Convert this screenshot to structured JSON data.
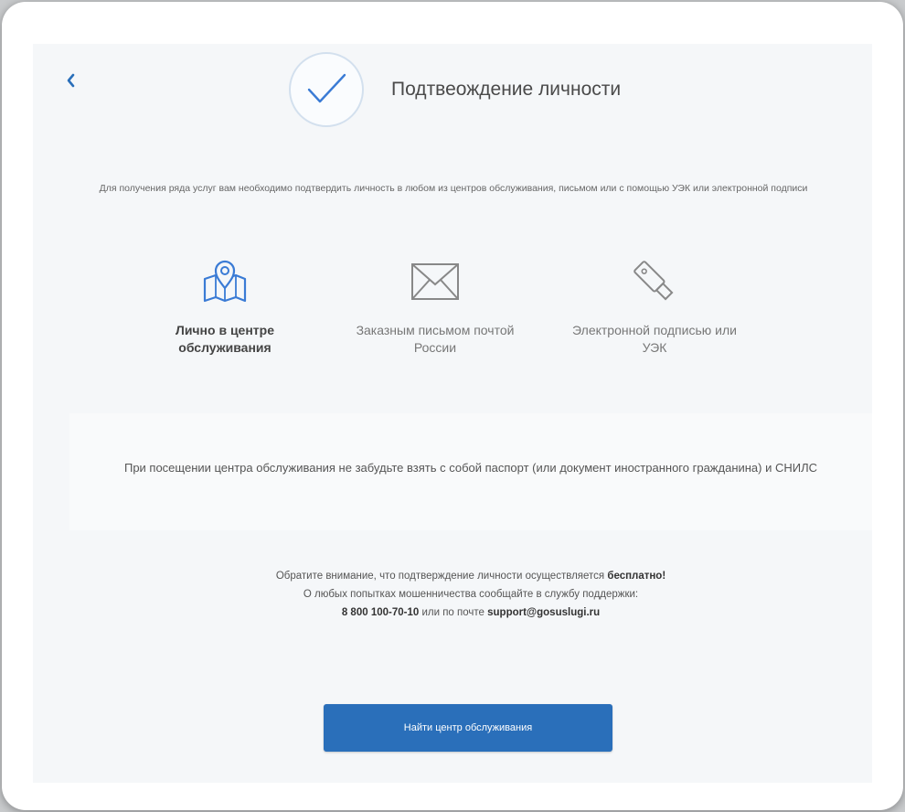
{
  "header": {
    "title": "Подтвеождение личности"
  },
  "intro": {
    "text": "Для получения ряда услуг вам необходимо подтвердить личность в любом из центров обслуживания, письмом или с помощью УЭК или электронной подписи"
  },
  "methods": [
    {
      "label": "Лично в центре обслуживания",
      "icon": "map-pin-icon",
      "active": true
    },
    {
      "label": "Заказным письмом почтой России",
      "icon": "envelope-icon",
      "active": false
    },
    {
      "label": "Электронной подписью или УЭК",
      "icon": "usb-key-icon",
      "active": false
    }
  ],
  "info": {
    "text": "При посещении центра обслуживания не забудьте взять с собой паспорт (или документ иностранного гражданина) и СНИЛС"
  },
  "notice": {
    "line1_prefix": "Обратите внимание, что подтверждение личности осуществляется",
    "line1_bold": "бесплатно!",
    "line2": "О любых попытках мошенничества сообщайте в службу поддержки:",
    "phone": "8 800 100-70-10",
    "line3_mid": "или по почте",
    "email": "support@gosuslugi.ru"
  },
  "actions": {
    "find_label": "Найти центр обслуживания"
  },
  "colors": {
    "accent": "#2a6fba",
    "icon_blue": "#3a7bd5"
  }
}
